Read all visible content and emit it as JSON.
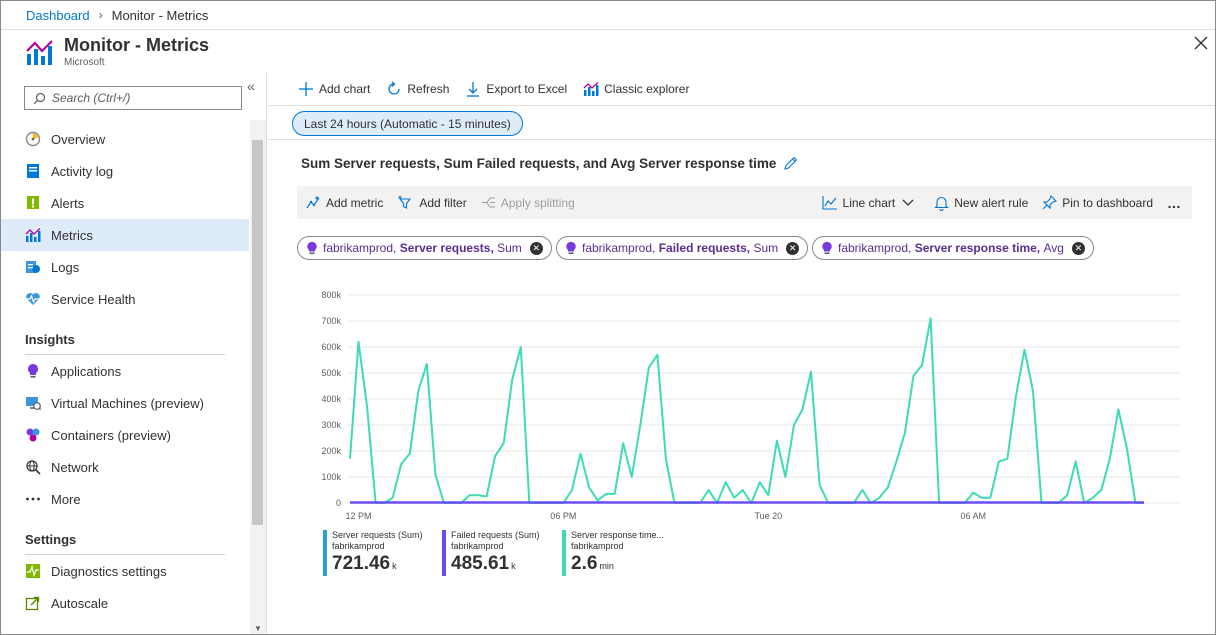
{
  "breadcrumb": {
    "home": "Dashboard",
    "current": "Monitor - Metrics"
  },
  "header": {
    "title": "Monitor - Metrics",
    "subtitle": "Microsoft"
  },
  "search": {
    "placeholder": "Search (Ctrl+/)"
  },
  "sidebar": {
    "items": [
      {
        "label": "Overview",
        "icon": "overview-icon"
      },
      {
        "label": "Activity log",
        "icon": "activity-log-icon"
      },
      {
        "label": "Alerts",
        "icon": "alerts-icon"
      },
      {
        "label": "Metrics",
        "icon": "metrics-icon",
        "active": true
      },
      {
        "label": "Logs",
        "icon": "logs-icon"
      },
      {
        "label": "Service Health",
        "icon": "service-health-icon"
      }
    ],
    "insights_title": "Insights",
    "insights": [
      {
        "label": "Applications",
        "icon": "applications-icon"
      },
      {
        "label": "Virtual Machines (preview)",
        "icon": "virtual-machines-icon"
      },
      {
        "label": "Containers (preview)",
        "icon": "containers-icon"
      },
      {
        "label": "Network",
        "icon": "network-icon"
      },
      {
        "label": "More",
        "icon": "more-icon"
      }
    ],
    "settings_title": "Settings",
    "settings": [
      {
        "label": "Diagnostics settings",
        "icon": "diagnostics-icon"
      },
      {
        "label": "Autoscale",
        "icon": "autoscale-icon"
      }
    ]
  },
  "toolbar": {
    "add_chart": "Add chart",
    "refresh": "Refresh",
    "export": "Export to Excel",
    "classic": "Classic explorer"
  },
  "time_range": "Last 24 hours (Automatic - 15 minutes)",
  "chart_title": "Sum Server requests, Sum Failed requests, and Avg Server response time",
  "chart_toolbar": {
    "add_metric": "Add metric",
    "add_filter": "Add filter",
    "apply_splitting": "Apply splitting",
    "line_chart": "Line chart",
    "new_alert": "New alert rule",
    "pin": "Pin to dashboard",
    "more": "…"
  },
  "pills": [
    {
      "resource": "fabrikamprod,",
      "metric": "Server requests,",
      "agg": "Sum"
    },
    {
      "resource": "fabrikamprod,",
      "metric": "Failed requests,",
      "agg": "Sum"
    },
    {
      "resource": "fabrikamprod,",
      "metric": "Server response time,",
      "agg": "Avg"
    }
  ],
  "colors": {
    "accent": "#0078d4",
    "server_requests": "#2c9cdd",
    "failed_requests": "#6a4df0",
    "response_time": "#3ddbb7",
    "purple": "#5c2d91"
  },
  "legend": [
    {
      "name": "Server requests (Sum)",
      "resource": "fabrikamprod",
      "value": "721.46",
      "unit": "k"
    },
    {
      "name": "Failed requests (Sum)",
      "resource": "fabrikamprod",
      "value": "485.61",
      "unit": "k"
    },
    {
      "name": "Server response time...",
      "resource": "fabrikamprod",
      "value": "2.6",
      "unit": "min"
    }
  ],
  "chart_data": {
    "type": "line",
    "ylim": [
      0,
      800000
    ],
    "yticks": [
      "0",
      "100k",
      "200k",
      "300k",
      "400k",
      "500k",
      "600k",
      "700k",
      "800k"
    ],
    "xticks": [
      "12 PM",
      "06 PM",
      "Tue 20",
      "06 AM"
    ],
    "xtick_index": [
      1,
      25,
      49,
      73
    ],
    "series": [
      {
        "name": "Server response time...",
        "values": [
          170000,
          620000,
          370000,
          0,
          0,
          20000,
          150000,
          190000,
          430000,
          535000,
          110000,
          0,
          0,
          0,
          30000,
          30000,
          25000,
          180000,
          230000,
          475000,
          600000,
          0,
          0,
          0,
          0,
          0,
          50000,
          190000,
          60000,
          10000,
          35000,
          35000,
          230000,
          100000,
          300000,
          520000,
          570000,
          170000,
          0,
          0,
          0,
          0,
          50000,
          0,
          80000,
          20000,
          50000,
          0,
          80000,
          30000,
          240000,
          100000,
          300000,
          360000,
          505000,
          70000,
          0,
          0,
          0,
          0,
          50000,
          0,
          20000,
          60000,
          160000,
          270000,
          490000,
          530000,
          710000,
          0,
          0,
          0,
          0,
          40000,
          20000,
          20000,
          160000,
          170000,
          410000,
          590000,
          430000,
          0,
          0,
          0,
          30000,
          160000,
          0,
          20000,
          50000,
          170000,
          360000,
          210000,
          0,
          0
        ]
      },
      {
        "name": "Failed requests (Sum)",
        "values": [
          2000,
          2000,
          2000,
          2000,
          2000,
          2000,
          2000,
          2000,
          2000,
          2000,
          2000,
          2000,
          2000,
          2000,
          2000,
          2000,
          2000,
          2000,
          2000,
          2000,
          2000,
          2000,
          2000,
          2000,
          2000,
          2000,
          2000,
          2000,
          2000,
          2000,
          2000,
          2000,
          2000,
          2000,
          2000,
          2000,
          2000,
          2000,
          2000,
          2000,
          2000,
          2000,
          2000,
          2000,
          2000,
          2000,
          2000,
          2000,
          2000,
          2000,
          2000,
          2000,
          2000,
          2000,
          2000,
          2000,
          2000,
          2000,
          2000,
          2000,
          2000,
          2000,
          2000,
          2000,
          2000,
          2000,
          2000,
          2000,
          2000,
          2000,
          2000,
          2000,
          2000,
          2000,
          2000,
          2000,
          2000,
          2000,
          2000,
          2000,
          2000,
          2000,
          2000,
          2000,
          2000,
          2000,
          2000,
          2000,
          2000,
          2000,
          2000,
          2000,
          2000,
          2000
        ]
      }
    ]
  }
}
